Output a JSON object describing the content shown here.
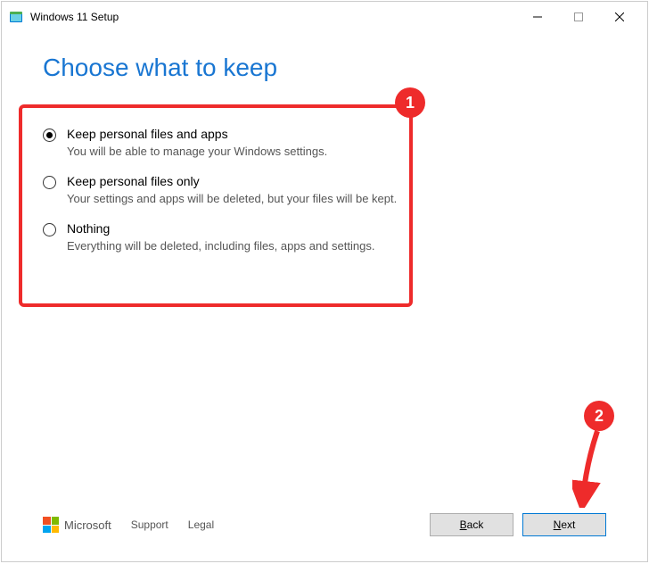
{
  "window": {
    "title": "Windows 11 Setup"
  },
  "heading": "Choose what to keep",
  "options": [
    {
      "title": "Keep personal files and apps",
      "desc": "You will be able to manage your Windows settings.",
      "checked": true
    },
    {
      "title": "Keep personal files only",
      "desc": "Your settings and apps will be deleted, but your files will be kept.",
      "checked": false
    },
    {
      "title": "Nothing",
      "desc": "Everything will be deleted, including files, apps and settings.",
      "checked": false
    }
  ],
  "footer": {
    "brand": "Microsoft",
    "support": "Support",
    "legal": "Legal",
    "back": "ack",
    "back_accel": "B",
    "next": "ext",
    "next_accel": "N"
  },
  "annotations": {
    "callout1": "1",
    "callout2": "2"
  },
  "colors": {
    "accent": "#1976d2",
    "annotation": "#ee2b2b",
    "ms_red": "#f25022",
    "ms_green": "#7fba00",
    "ms_blue": "#00a4ef",
    "ms_yellow": "#ffb900"
  }
}
